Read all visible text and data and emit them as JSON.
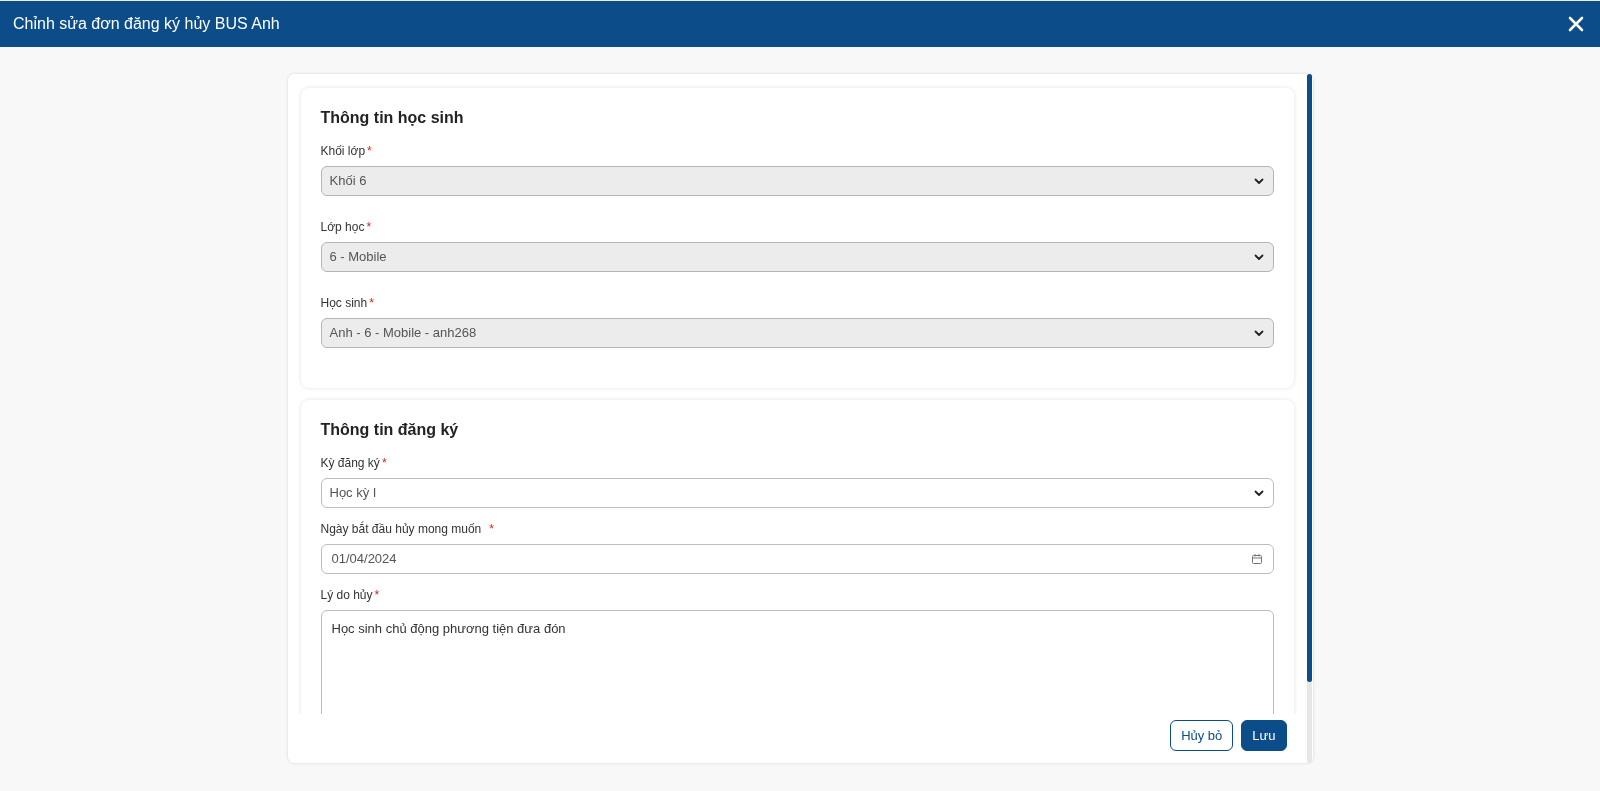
{
  "window": {
    "title": "Chỉnh sửa đơn đăng ký hủy BUS Anh"
  },
  "sections": [
    {
      "title": "Thông tin học sinh",
      "fields": [
        {
          "kind": "select",
          "label": "Khối lớp",
          "required_mark": "*",
          "value": "Khối 6",
          "disabled": true
        },
        {
          "kind": "select",
          "label": "Lớp học",
          "required_mark": "*",
          "value": "6 - Mobile",
          "disabled": true
        },
        {
          "kind": "select",
          "label": "Học sinh",
          "required_mark": "*",
          "value": "Anh - 6 - Mobile - anh268",
          "disabled": true
        }
      ]
    },
    {
      "title": "Thông tin đăng ký",
      "fields": [
        {
          "kind": "select",
          "label": "Kỳ đăng ký",
          "required_mark": "*",
          "value": "Học kỳ I",
          "disabled": false
        },
        {
          "kind": "date",
          "label": "Ngày bắt đầu hủy mong muốn",
          "required_mark": "*",
          "value": "01/04/2024",
          "disabled": false
        },
        {
          "kind": "textarea",
          "label": "Lý do hủy",
          "required_mark": "*",
          "value": "Học sinh chủ động phương tiện đưa đón",
          "disabled": false
        }
      ]
    }
  ],
  "buttons": [
    {
      "kind": "secondary",
      "label": "Hủy bỏ"
    },
    {
      "kind": "primary",
      "label": "Lưu"
    }
  ]
}
